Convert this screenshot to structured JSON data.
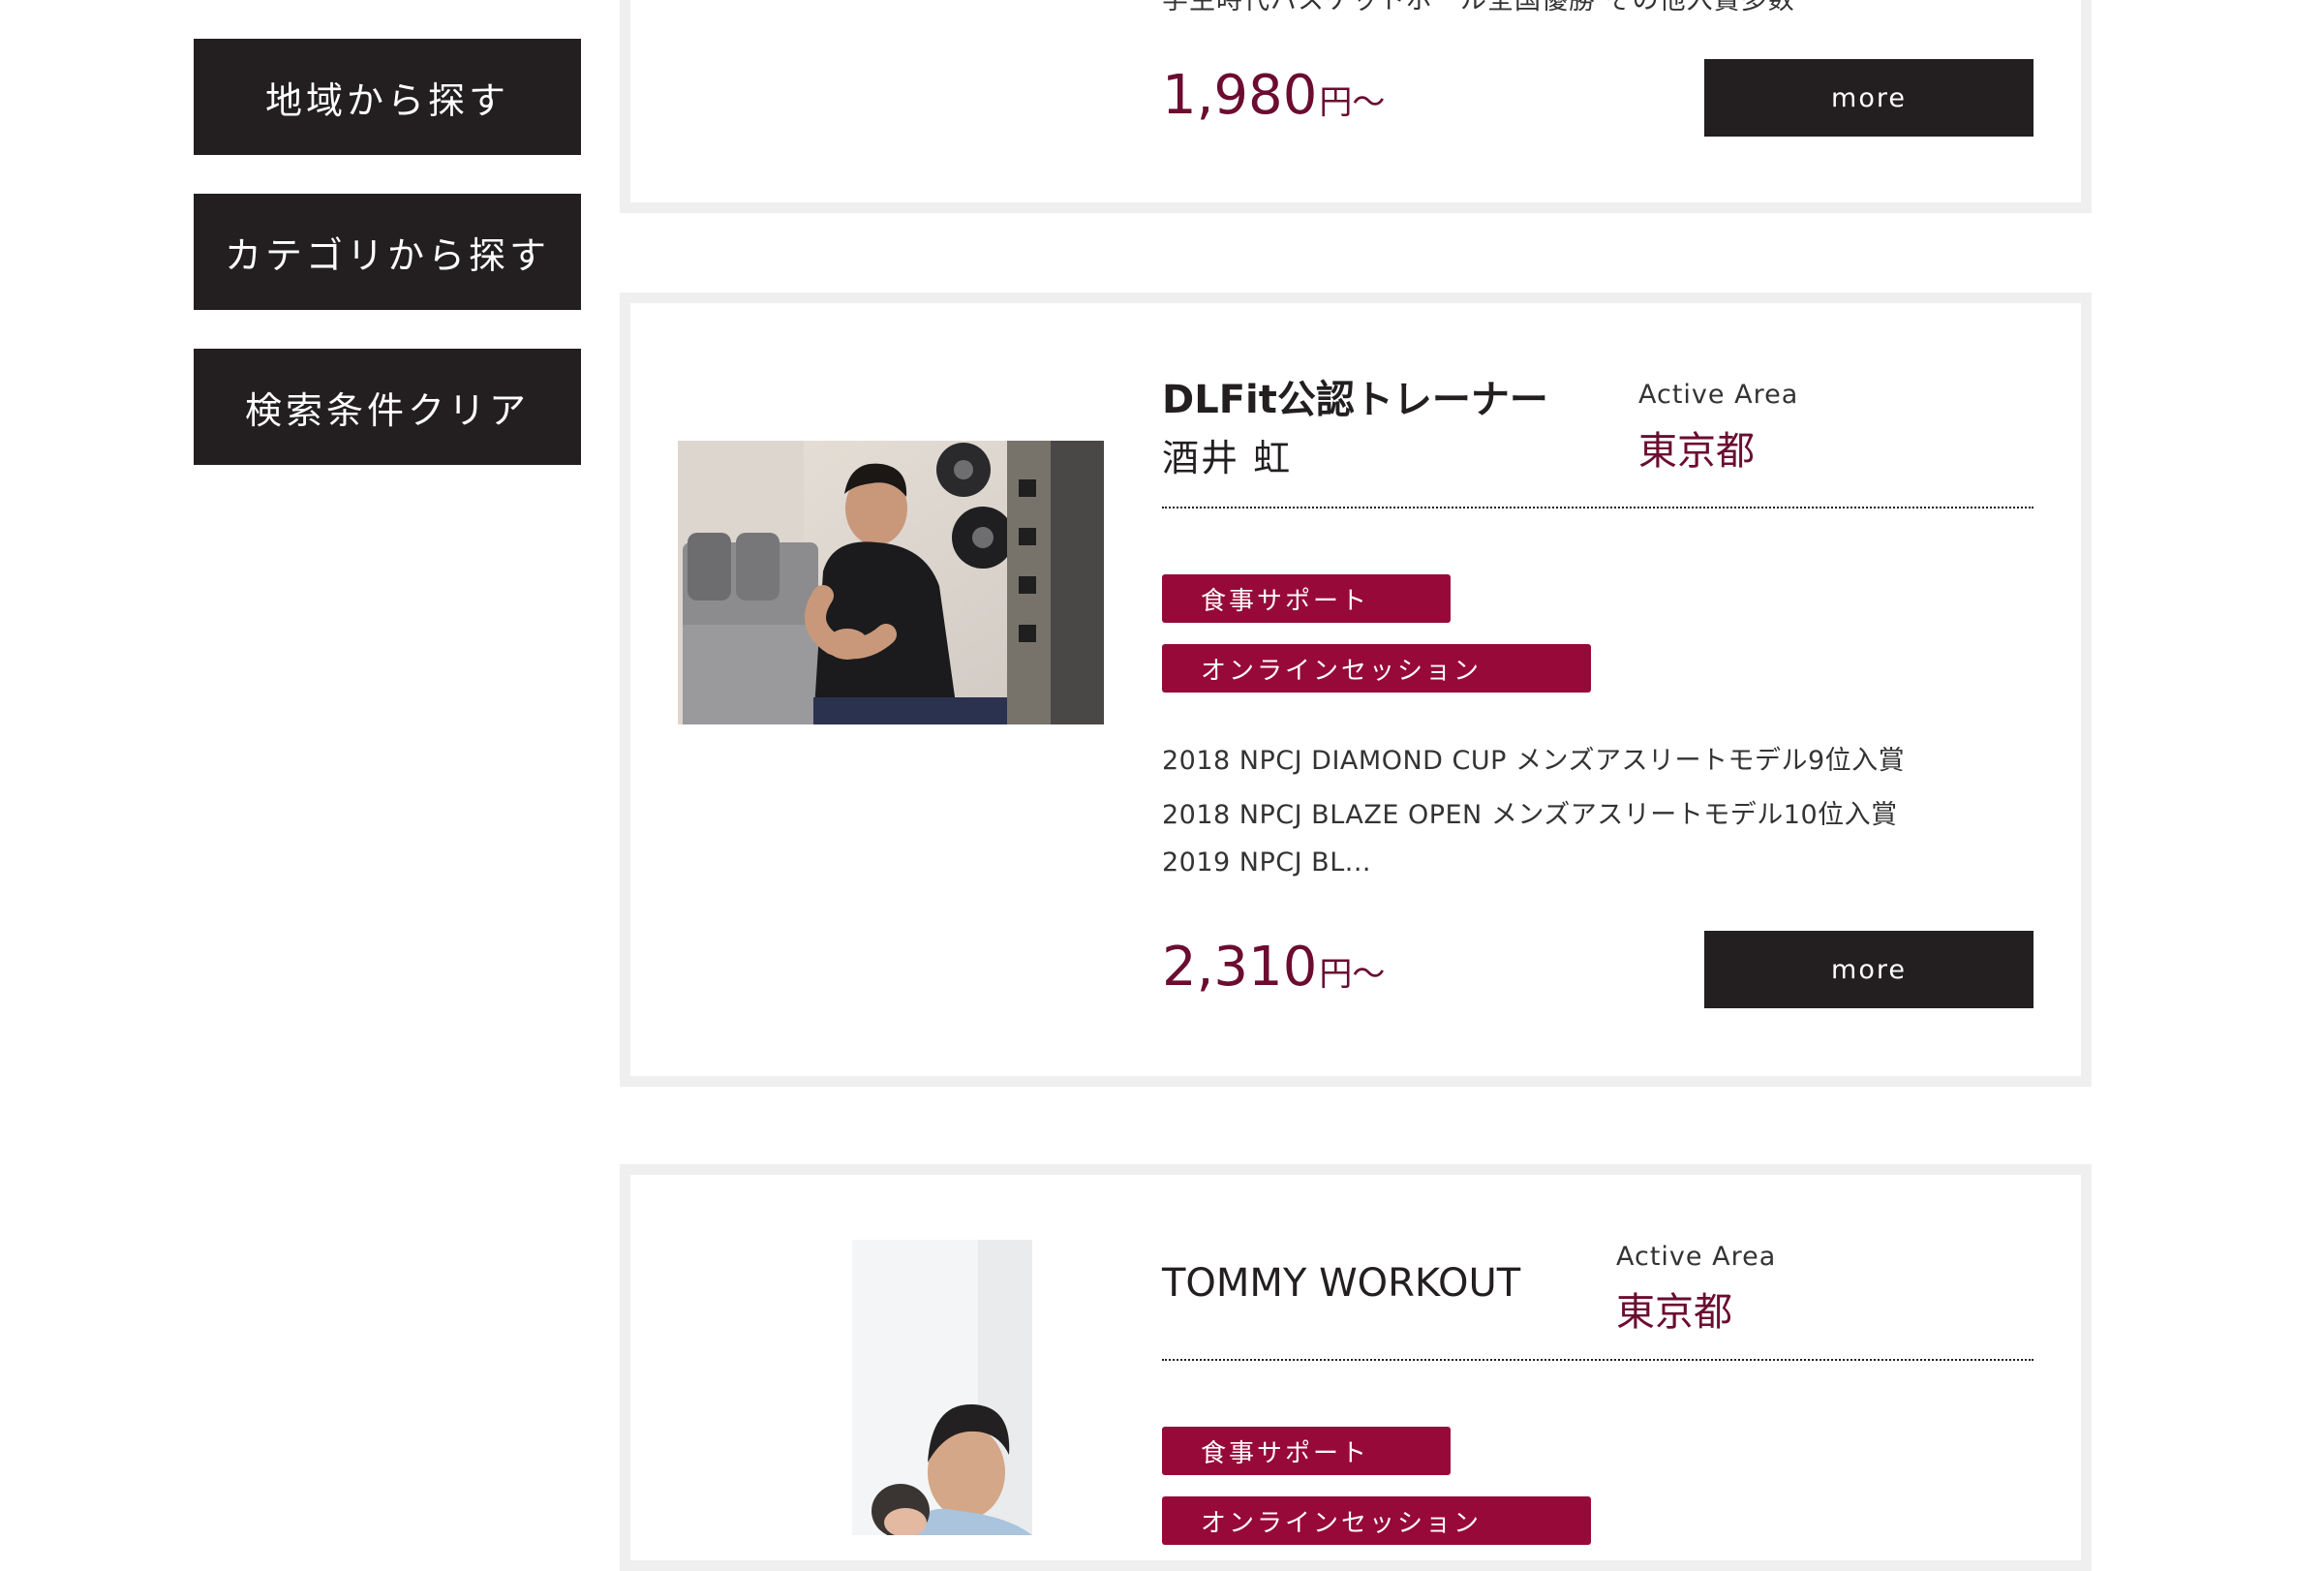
{
  "sidebar": {
    "buttons": [
      {
        "label": "地域から探す"
      },
      {
        "label": "カテゴリから探す"
      },
      {
        "label": "検索条件クリア"
      }
    ]
  },
  "cards": [
    {
      "desc_fragment": "学生時代バスケットボール全国優勝 その他入賞多数",
      "price": "1,980",
      "price_unit": "円〜",
      "more_label": "more"
    },
    {
      "title": "DLFit公認トレーナー",
      "name": "酒井 虹",
      "area_label": "Active Area",
      "area_value": "東京都",
      "tags": [
        "食事サポート",
        "オンラインセッション"
      ],
      "description": [
        "2018 NPCJ DIAMOND CUP メンズアスリートモデル9位入賞",
        "2018 NPCJ BLAZE OPEN メンズアスリートモデル10位入賞",
        "2019 NPCJ BL..."
      ],
      "price": "2,310",
      "price_unit": "円〜",
      "more_label": "more"
    },
    {
      "title": "TOMMY WORKOUT",
      "area_label": "Active Area",
      "area_value": "東京都",
      "tags": [
        "食事サポート",
        "オンラインセッション"
      ]
    }
  ],
  "colors": {
    "dark": "#231f20",
    "accent": "#6b0c30",
    "tag": "#970939",
    "card_border": "#f0efef"
  }
}
